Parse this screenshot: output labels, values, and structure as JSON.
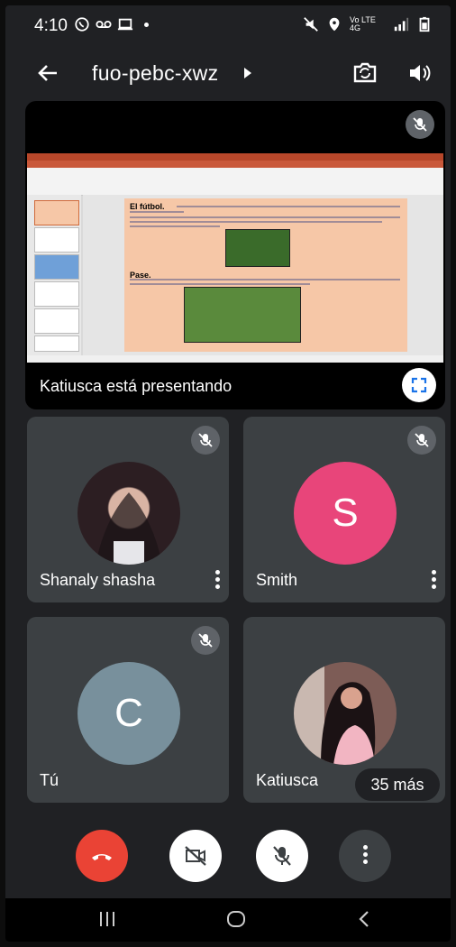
{
  "status_bar": {
    "time": "4:10",
    "network": "Vo LTE 4G"
  },
  "header": {
    "meeting_code": "fuo-pebc-xwz"
  },
  "presentation": {
    "presenter_label": "Katiusca está presentando",
    "slide": {
      "heading1": "El fútbol.",
      "heading2": "Pase."
    }
  },
  "participants": [
    {
      "name": "Shanaly shasha",
      "muted": true,
      "avatar": "photo"
    },
    {
      "name": "Smith",
      "muted": true,
      "avatar_letter": "S",
      "avatar_color": "#e8457a"
    },
    {
      "name": "Tú",
      "muted": true,
      "avatar_letter": "C",
      "avatar_color": "#78909c"
    },
    {
      "name": "Katiusca",
      "muted": false,
      "avatar": "photo"
    }
  ],
  "more_participants_label": "35 más",
  "controls": {
    "end_call_color": "#ea4335",
    "camera": "video-off-icon",
    "mic": "mic-off-icon",
    "more": "more-vert-icon"
  },
  "nav": [
    "recents-icon",
    "home-icon",
    "back-icon"
  ]
}
